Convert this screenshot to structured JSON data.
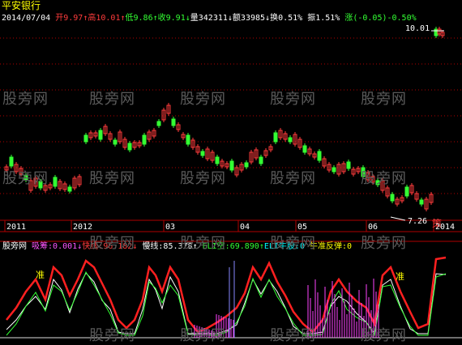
{
  "header": {
    "title": "平安银行",
    "date": "2014/07/04",
    "open_label": "开",
    "open_value": "9.97",
    "open_arrow": "↑",
    "high_label": "高",
    "high_value": "10.01",
    "high_arrow": "↑",
    "low_label": "低",
    "low_value": "9.86",
    "low_arrow": "↑",
    "close_label": "收",
    "close_value": "9.91",
    "close_arrow": "↓",
    "volume_label": "量",
    "volume_value": "342311",
    "volume_arrow": "↓",
    "amount_label": "额",
    "amount_value": "33985",
    "amount_arrow": "↓",
    "turnover_label": "换",
    "turnover_value": "0.51%",
    "amplitude_label": "振",
    "amplitude_value": "1.51%",
    "change_label": "涨",
    "change_value": "(-0.05)-0.50%"
  },
  "price_panel": {
    "max_label": "10.01",
    "min_label": "7.26",
    "buy_marker": "策"
  },
  "time_axis": [
    "2011",
    "2012",
    "03",
    "04",
    "05",
    "06",
    "2014"
  ],
  "indicators": {
    "name": "股旁网",
    "xichou": "吸筹:0.001",
    "xichou_arrow": "↓",
    "kuaixian": "快线:96.182",
    "kuaixian_arrow": "↓",
    "manxian": "慢线:85.378",
    "manxian_arrow": "↑",
    "eli_kong": "ELI空:69.890",
    "eli_kong_arrow": "↑",
    "eli_niu": "ELI牛股:0",
    "niu_zhun": "牛准反弹:0"
  },
  "markers": {
    "label": "准"
  },
  "watermark": "股旁网",
  "colors": {
    "up": "#ff3c3c",
    "down": "#33ff33",
    "grid": "#b00000",
    "fast": "#ff2020",
    "slow": "#ffffff",
    "eli": "#33ff33",
    "volume": "#ff44ff"
  }
}
